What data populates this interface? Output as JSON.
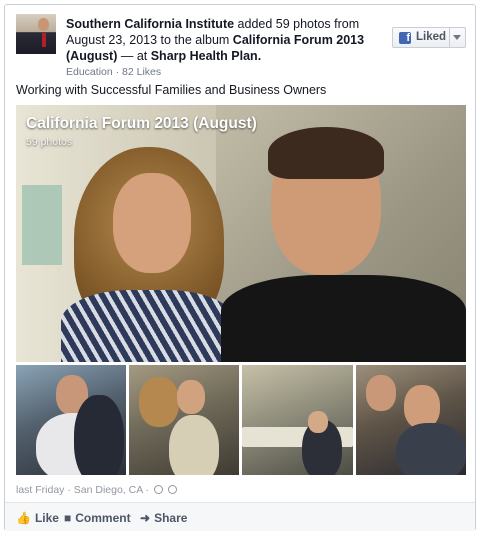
{
  "story": {
    "actor": "Southern California Institute",
    "text_1": " added 59 photos from August 23, 2013 to the album ",
    "album": "California Forum 2013 (August)",
    "text_2": " — at ",
    "place": "Sharp Health Plan."
  },
  "meta": "Education · 82 Likes",
  "liked_button": {
    "label": "Liked"
  },
  "message": "Working with Successful Families and Business Owners",
  "album_overlay": {
    "title": "California Forum 2013 (August)",
    "count": "59 photos"
  },
  "footer": {
    "time_place": "last Friday · San Diego, CA ·"
  },
  "actions": {
    "like": "Like",
    "comment": "Comment",
    "share": "Share"
  },
  "icons": [
    "facebook-icon",
    "caret-down-icon",
    "globe-icon",
    "clock-icon",
    "like-icon",
    "comment-icon",
    "share-icon"
  ],
  "colors": {
    "link": "#141823",
    "accent": "#4267b2",
    "muted": "#9197a3"
  }
}
